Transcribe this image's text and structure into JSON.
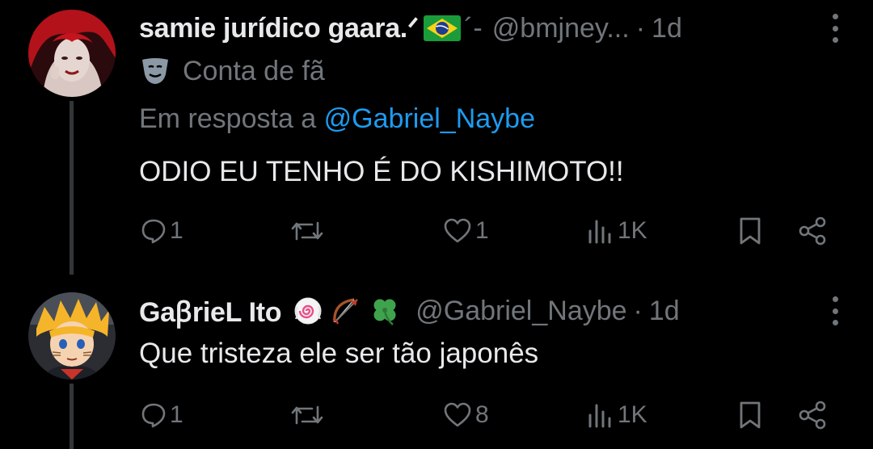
{
  "tweets": [
    {
      "display_name": "samie jurídico gaara.ᐟ",
      "name_suffix": "´-",
      "handle": "@bmjney...",
      "separator": "·",
      "time": "1d",
      "badge_label": "Conta de fã",
      "reply_prefix": "Em resposta a",
      "reply_to": "@Gabriel_Naybe",
      "text": "ODIO EU TENHO É DO KISHIMOTO!!",
      "actions": {
        "replies": "1",
        "retweets": "",
        "likes": "1",
        "views": "1K"
      },
      "avatar": "avatar-red-hair",
      "flag_icon": "brazil-flag-icon"
    },
    {
      "display_name": "GaꞵrieL Ito",
      "handle": "@Gabriel_Naybe",
      "separator": "·",
      "time": "1d",
      "text": "Que tristeza ele ser tão japonês",
      "actions": {
        "replies": "1",
        "retweets": "",
        "likes": "8",
        "views": "1K"
      },
      "avatar": "avatar-naruto",
      "emoji_icons": [
        "narutomaki-icon",
        "bow-and-arrow-icon",
        "four-leaf-clover-icon"
      ]
    }
  ],
  "colors": {
    "background": "#000000",
    "text": "#e7e9ea",
    "muted": "#71767b",
    "link": "#1d9bf0",
    "thread_line": "#333639"
  }
}
